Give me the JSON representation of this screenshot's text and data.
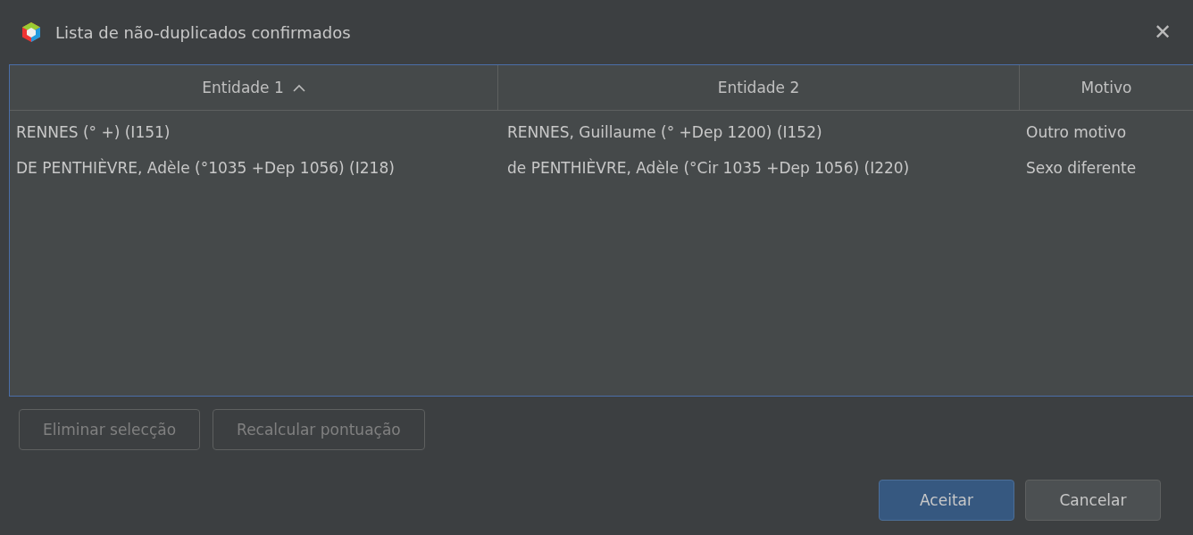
{
  "window": {
    "title": "Lista de não-duplicados confirmados",
    "close": "✕"
  },
  "table": {
    "columns": [
      {
        "label": "Entidade 1",
        "sorted": true
      },
      {
        "label": "Entidade 2",
        "sorted": false
      },
      {
        "label": "Motivo",
        "sorted": false
      }
    ],
    "rows": [
      [
        "RENNES (° +) (I151)",
        "RENNES, Guillaume (° +Dep 1200) (I152)",
        "Outro motivo"
      ],
      [
        "DE PENTHIÈVRE, Adèle (°1035 +Dep 1056) (I218)",
        "de PENTHIÈVRE, Adèle (°Cir 1035 +Dep 1056) (I220)",
        "Sexo diferente"
      ]
    ]
  },
  "actions": [
    {
      "label": "Eliminar selecção",
      "disabled": true
    },
    {
      "label": "Recalcular pontuação",
      "disabled": true
    }
  ],
  "buttons": [
    {
      "label": "Aceitar",
      "default": true
    },
    {
      "label": "Cancelar",
      "default": false
    }
  ]
}
